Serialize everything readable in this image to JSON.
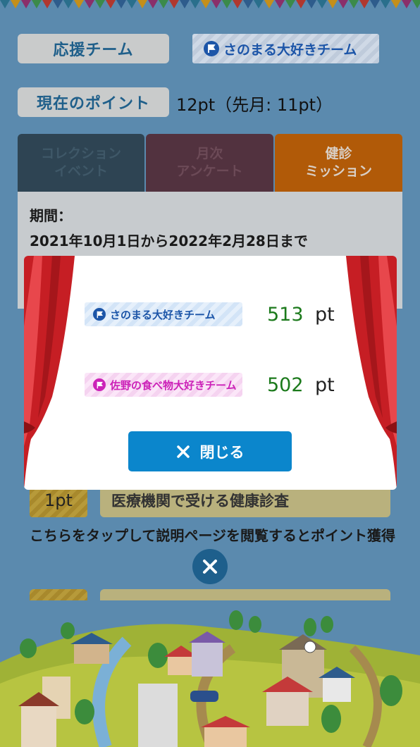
{
  "header": {
    "support_team_label": "応援チーム",
    "support_team_name": "さのまる大好きチーム",
    "current_points_label": "現在のポイント",
    "current_points_value": "12pt（先月: 11pt）"
  },
  "tabs": [
    {
      "line1": "コレクション",
      "line2": "イベント"
    },
    {
      "line1": "月次",
      "line2": "アンケート"
    },
    {
      "line1": "健診",
      "line2": "ミッション"
    }
  ],
  "panel": {
    "period_label": "期間：",
    "period_text": "2021年10月1日から2022年2月28日まで"
  },
  "mission": {
    "points": "1pt",
    "title": "医療機関で受ける健康診査",
    "description": "こちらをタップして説明ページを閲覧するとポイント獲得"
  },
  "modal": {
    "teams": [
      {
        "name": "さのまる大好きチーム",
        "score": "513",
        "unit": "pt"
      },
      {
        "name": "佐野の食べ物大好きチーム",
        "score": "502",
        "unit": "pt"
      }
    ],
    "close_label": "閉じる"
  },
  "colors": {
    "background": "#5b8aae",
    "tab_collection": "#2e4453",
    "tab_survey": "#52323f",
    "tab_mission": "#b15a08",
    "team1_accent": "#1c55a8",
    "team2_accent": "#cc22b8",
    "score_green": "#1c7a1c",
    "close_button": "#0b86cc"
  }
}
